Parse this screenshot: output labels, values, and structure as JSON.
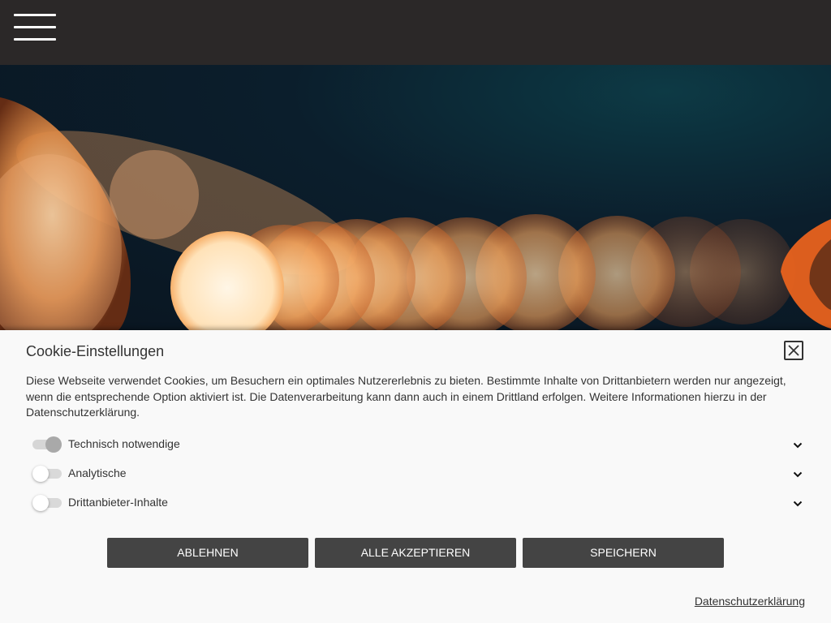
{
  "header": {
    "menu_icon": "hamburger-menu-icon"
  },
  "hero": {
    "image": "bokeh-lightbulb-photo",
    "colors": {
      "background": "#0b1e2c",
      "accent": "#f08a3c"
    }
  },
  "cookie": {
    "title": "Cookie-Einstellungen",
    "close_icon": "close-icon",
    "description": "Diese Webseite verwendet Cookies, um Besuchern ein optimales Nutzererlebnis zu bieten. Bestimmte Inhalte von Drittanbietern werden nur angezeigt, wenn die entsprechende Option aktiviert ist. Die Datenverarbeitung kann dann auch in einem Drittland erfolgen. Weitere Informationen hierzu in der Datenschutzerklärung.",
    "options": [
      {
        "label": "Technisch notwendige",
        "enabled": true,
        "locked": true,
        "icon": "chevron-down-icon"
      },
      {
        "label": "Analytische",
        "enabled": false,
        "locked": false,
        "icon": "chevron-down-icon"
      },
      {
        "label": "Drittanbieter-Inhalte",
        "enabled": false,
        "locked": false,
        "icon": "chevron-down-icon"
      }
    ],
    "buttons": {
      "reject": "ABLEHNEN",
      "accept_all": "ALLE AKZEPTIEREN",
      "save": "SPEICHERN"
    },
    "privacy_link": "Datenschutzerklärung",
    "colors": {
      "panel": "#f9f9f9",
      "button": "#444444",
      "text": "#333333"
    }
  }
}
